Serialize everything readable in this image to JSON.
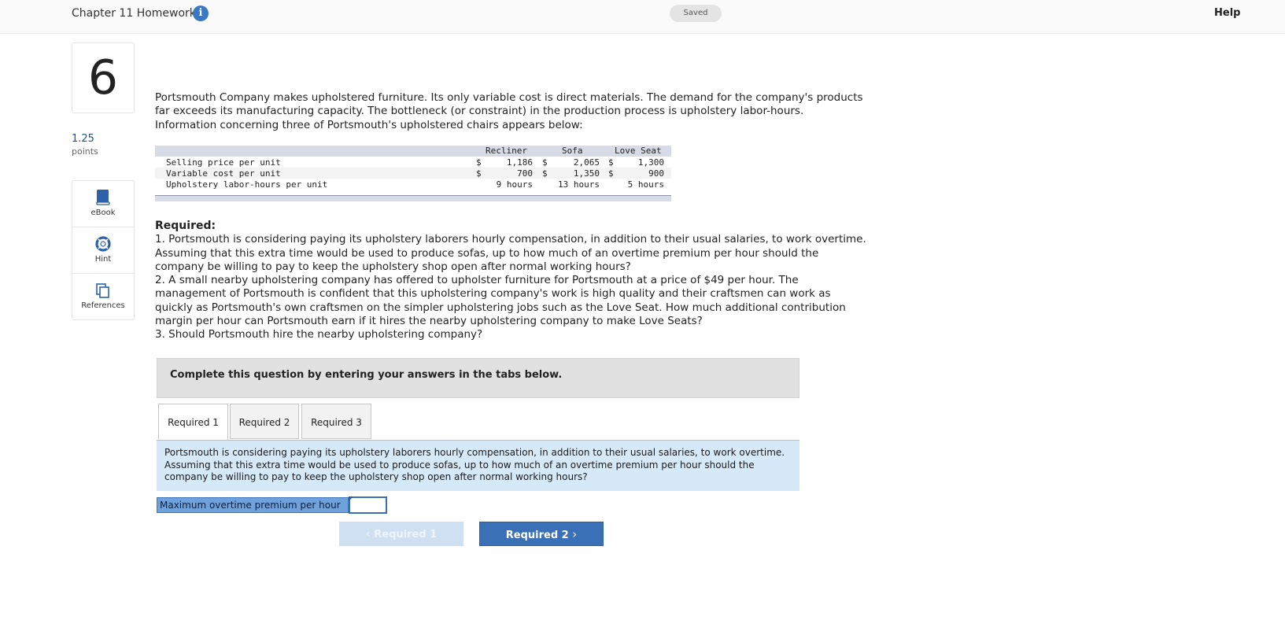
{
  "header": {
    "title": "Chapter 11 Homework",
    "info_glyph": "i",
    "status": "Saved",
    "help": "Help"
  },
  "question": {
    "number": "6",
    "points_value": "1.25",
    "points_label": "points"
  },
  "tools": [
    {
      "label": "eBook",
      "icon": "book-icon"
    },
    {
      "label": "Hint",
      "icon": "lifebuoy-icon"
    },
    {
      "label": "References",
      "icon": "copy-pages-icon"
    }
  ],
  "problem": {
    "intro": "Portsmouth Company makes upholstered furniture. Its only variable cost is direct materials. The demand for the company's products far exceeds its manufacturing capacity. The bottleneck (or constraint) in the production process is upholstery labor-hours. Information concerning three of Portsmouth's upholstered chairs appears below:"
  },
  "data_table": {
    "columns": [
      "Recliner",
      "Sofa",
      "Love Seat"
    ],
    "rows": [
      {
        "label": "Selling price per unit",
        "cur1": "$",
        "c1": "1,186",
        "cur2": "$",
        "c2": "2,065",
        "cur3": "$",
        "c3": "1,300"
      },
      {
        "label": "Variable cost per unit",
        "cur1": "$",
        "c1": "700",
        "cur2": "$",
        "c2": "1,350",
        "cur3": "$",
        "c3": "900"
      },
      {
        "label": "Upholstery labor-hours per unit",
        "cur1": "",
        "c1": "9 hours",
        "cur2": "",
        "c2": "13 hours",
        "cur3": "",
        "c3": "5 hours"
      }
    ]
  },
  "required": {
    "heading": "Required:",
    "items": [
      "1. Portsmouth is considering paying its upholstery laborers hourly compensation, in addition to their usual salaries, to work overtime. Assuming that this extra time would be used to produce sofas, up to how much of an overtime premium per hour should the company be willing to pay to keep the upholstery shop open after normal working hours?",
      "2. A small nearby upholstering company has offered to upholster furniture for Portsmouth at a price of $49 per hour. The management of Portsmouth is confident that this upholstering company's work is high quality and their craftsmen can work as quickly as Portsmouth's own craftsmen on the simpler upholstering jobs such as the Love Seat. How much additional contribution margin per hour can Portsmouth earn if it hires the nearby upholstering company to make Love Seats?",
      "3. Should Portsmouth hire the nearby upholstering company?"
    ]
  },
  "instructions": "Complete this question by entering your answers in the tabs below.",
  "tabs": [
    {
      "label": "Required 1",
      "active": true
    },
    {
      "label": "Required 2",
      "active": false
    },
    {
      "label": "Required 3",
      "active": false
    }
  ],
  "active_prompt": "Portsmouth is considering paying its upholstery laborers hourly compensation, in addition to their usual salaries, to work overtime. Assuming that this extra time would be used to produce sofas, up to how much of an overtime premium per hour should the company be willing to pay to keep the upholstery shop open after normal working hours?",
  "answer": {
    "label": "Maximum overtime premium per hour",
    "value": ""
  },
  "nav": {
    "prev_glyph": "‹",
    "prev_label": "Required 1",
    "next_label": "Required 2",
    "next_glyph": "›"
  },
  "colors": {
    "accent": "#3a70b6",
    "prompt_bg": "#d6e9f8",
    "table_header": "#d6dbe6",
    "points": "#1d4f91"
  }
}
